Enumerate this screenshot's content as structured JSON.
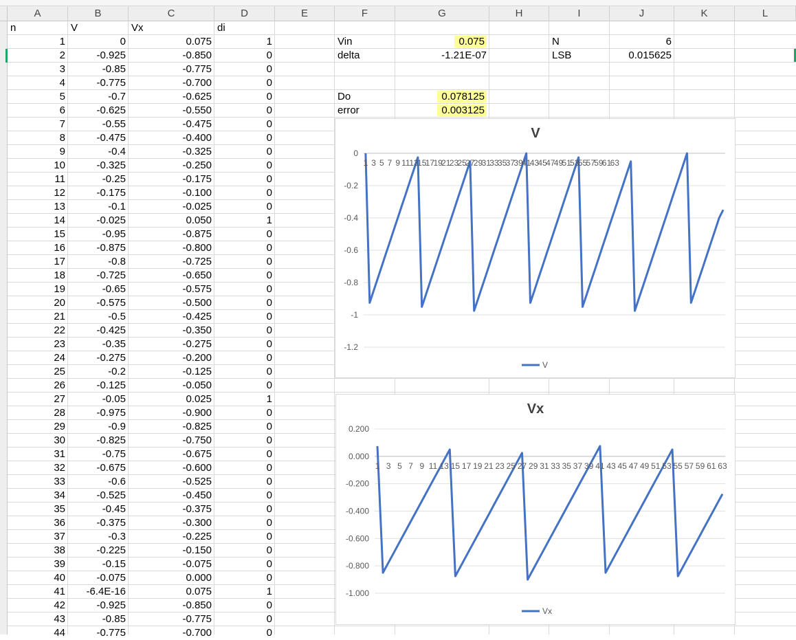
{
  "columns": [
    "A",
    "B",
    "C",
    "D",
    "E",
    "F",
    "G",
    "H",
    "I",
    "J",
    "K",
    "L"
  ],
  "headers": {
    "a": "n",
    "b": "V",
    "c": "Vx",
    "d": "di"
  },
  "table": [
    [
      "1",
      "0",
      "0.075",
      "1"
    ],
    [
      "2",
      "-0.925",
      "-0.850",
      "0"
    ],
    [
      "3",
      "-0.85",
      "-0.775",
      "0"
    ],
    [
      "4",
      "-0.775",
      "-0.700",
      "0"
    ],
    [
      "5",
      "-0.7",
      "-0.625",
      "0"
    ],
    [
      "6",
      "-0.625",
      "-0.550",
      "0"
    ],
    [
      "7",
      "-0.55",
      "-0.475",
      "0"
    ],
    [
      "8",
      "-0.475",
      "-0.400",
      "0"
    ],
    [
      "9",
      "-0.4",
      "-0.325",
      "0"
    ],
    [
      "10",
      "-0.325",
      "-0.250",
      "0"
    ],
    [
      "11",
      "-0.25",
      "-0.175",
      "0"
    ],
    [
      "12",
      "-0.175",
      "-0.100",
      "0"
    ],
    [
      "13",
      "-0.1",
      "-0.025",
      "0"
    ],
    [
      "14",
      "-0.025",
      "0.050",
      "1"
    ],
    [
      "15",
      "-0.95",
      "-0.875",
      "0"
    ],
    [
      "16",
      "-0.875",
      "-0.800",
      "0"
    ],
    [
      "17",
      "-0.8",
      "-0.725",
      "0"
    ],
    [
      "18",
      "-0.725",
      "-0.650",
      "0"
    ],
    [
      "19",
      "-0.65",
      "-0.575",
      "0"
    ],
    [
      "20",
      "-0.575",
      "-0.500",
      "0"
    ],
    [
      "21",
      "-0.5",
      "-0.425",
      "0"
    ],
    [
      "22",
      "-0.425",
      "-0.350",
      "0"
    ],
    [
      "23",
      "-0.35",
      "-0.275",
      "0"
    ],
    [
      "24",
      "-0.275",
      "-0.200",
      "0"
    ],
    [
      "25",
      "-0.2",
      "-0.125",
      "0"
    ],
    [
      "26",
      "-0.125",
      "-0.050",
      "0"
    ],
    [
      "27",
      "-0.05",
      "0.025",
      "1"
    ],
    [
      "28",
      "-0.975",
      "-0.900",
      "0"
    ],
    [
      "29",
      "-0.9",
      "-0.825",
      "0"
    ],
    [
      "30",
      "-0.825",
      "-0.750",
      "0"
    ],
    [
      "31",
      "-0.75",
      "-0.675",
      "0"
    ],
    [
      "32",
      "-0.675",
      "-0.600",
      "0"
    ],
    [
      "33",
      "-0.6",
      "-0.525",
      "0"
    ],
    [
      "34",
      "-0.525",
      "-0.450",
      "0"
    ],
    [
      "35",
      "-0.45",
      "-0.375",
      "0"
    ],
    [
      "36",
      "-0.375",
      "-0.300",
      "0"
    ],
    [
      "37",
      "-0.3",
      "-0.225",
      "0"
    ],
    [
      "38",
      "-0.225",
      "-0.150",
      "0"
    ],
    [
      "39",
      "-0.15",
      "-0.075",
      "0"
    ],
    [
      "40",
      "-0.075",
      "0.000",
      "0"
    ],
    [
      "41",
      "-6.4E-16",
      "0.075",
      "1"
    ],
    [
      "42",
      "-0.925",
      "-0.850",
      "0"
    ],
    [
      "43",
      "-0.85",
      "-0.775",
      "0"
    ],
    [
      "44",
      "-0.775",
      "-0.700",
      "0"
    ]
  ],
  "params": {
    "vin_label": "Vin",
    "vin_value": "0.075",
    "delta_label": "delta",
    "delta_value": "-1.21E-07",
    "n_label": "N",
    "n_value": "6",
    "lsb_label": "LSB",
    "lsb_value": "0.015625",
    "do_label": "Do",
    "do_value": "0.078125",
    "error_label": "error",
    "error_value": "0.003125"
  },
  "highlight_color": "#ffff99",
  "series_color": "#4472c4",
  "chart_data": [
    {
      "type": "line",
      "title": "V",
      "series": [
        {
          "name": "V",
          "values": [
            0,
            -0.925,
            -0.85,
            -0.775,
            -0.7,
            -0.625,
            -0.55,
            -0.475,
            -0.4,
            -0.325,
            -0.25,
            -0.175,
            -0.1,
            -0.025,
            -0.95,
            -0.875,
            -0.8,
            -0.725,
            -0.65,
            -0.575,
            -0.5,
            -0.425,
            -0.35,
            -0.275,
            -0.2,
            -0.125,
            -0.05,
            -0.975,
            -0.9,
            -0.825,
            -0.75,
            -0.675,
            -0.6,
            -0.525,
            -0.45,
            -0.375,
            -0.3,
            -0.225,
            -0.15,
            -0.075,
            0,
            -0.925,
            -0.85,
            -0.775,
            -0.7,
            -0.625,
            -0.55,
            -0.475,
            -0.4,
            -0.325,
            -0.25,
            -0.175,
            -0.1,
            -0.025,
            -0.95,
            -0.875,
            -0.8,
            -0.725,
            -0.65,
            -0.575,
            -0.5,
            -0.425,
            -0.35,
            -0.275,
            -0.2,
            -0.125,
            -0.05,
            -0.975,
            -0.9,
            -0.825,
            -0.75,
            -0.675,
            -0.6,
            -0.525,
            -0.45,
            -0.375,
            -0.3,
            -0.225,
            -0.15,
            -0.075,
            0,
            -0.925,
            -0.85,
            -0.775,
            -0.7,
            -0.625,
            -0.55,
            -0.475,
            -0.4,
            -0.35
          ]
        }
      ],
      "y_ticks": [
        "0",
        "-0.2",
        "-0.4",
        "-0.6",
        "-0.8",
        "-1",
        "-1.2"
      ],
      "ylim": [
        -1.2,
        0
      ],
      "x_tick_labels": [
        "1",
        "3",
        "5",
        "7",
        "9",
        "11",
        "13",
        "15",
        "17",
        "19",
        "21",
        "23",
        "25",
        "27",
        "29",
        "31",
        "33",
        "35",
        "37",
        "39",
        "41",
        "43",
        "45",
        "47",
        "49",
        "51",
        "53",
        "55",
        "57",
        "59",
        "61",
        "63"
      ],
      "legend": "bottom",
      "grid": true
    },
    {
      "type": "line",
      "title": "Vx",
      "series": [
        {
          "name": "Vx",
          "values": [
            0.075,
            -0.85,
            -0.775,
            -0.7,
            -0.625,
            -0.55,
            -0.475,
            -0.4,
            -0.325,
            -0.25,
            -0.175,
            -0.1,
            -0.025,
            0.05,
            -0.875,
            -0.8,
            -0.725,
            -0.65,
            -0.575,
            -0.5,
            -0.425,
            -0.35,
            -0.275,
            -0.2,
            -0.125,
            -0.05,
            0.025,
            -0.9,
            -0.825,
            -0.75,
            -0.675,
            -0.6,
            -0.525,
            -0.45,
            -0.375,
            -0.3,
            -0.225,
            -0.15,
            -0.075,
            0,
            0.075,
            -0.85,
            -0.775,
            -0.7,
            -0.625,
            -0.55,
            -0.475,
            -0.4,
            -0.325,
            -0.25,
            -0.175,
            -0.1,
            -0.025,
            0.05,
            -0.875,
            -0.8,
            -0.725,
            -0.65,
            -0.575,
            -0.5,
            -0.425,
            -0.35,
            -0.275
          ]
        }
      ],
      "y_ticks": [
        "0.200",
        "0.000",
        "-0.200",
        "-0.400",
        "-0.600",
        "-0.800",
        "-1.000"
      ],
      "ylim": [
        -1.0,
        0.2
      ],
      "x_tick_labels": [
        "1",
        "3",
        "5",
        "7",
        "9",
        "11",
        "13",
        "15",
        "17",
        "19",
        "21",
        "23",
        "25",
        "27",
        "29",
        "31",
        "33",
        "35",
        "37",
        "39",
        "41",
        "43",
        "45",
        "47",
        "49",
        "51",
        "53",
        "55",
        "57",
        "59",
        "61",
        "63"
      ],
      "legend": "bottom",
      "grid": true
    }
  ]
}
